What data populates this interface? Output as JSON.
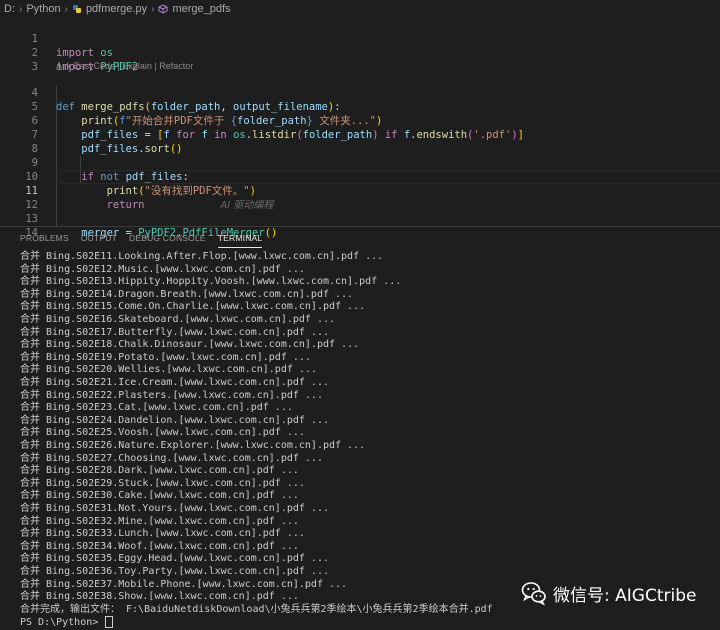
{
  "breadcrumb": {
    "drive": "D:",
    "folder": "Python",
    "file": "pdfmerge.py",
    "symbol": "merge_pdfs"
  },
  "editor": {
    "codelens": "Ask EasyCode | Explain | Refactor",
    "ghost_text": "AI 驱动编程",
    "line_numbers": [
      "1",
      "2",
      "3",
      "4",
      "5",
      "6",
      "7",
      "8",
      "9",
      "10",
      "11",
      "12",
      "13",
      "14"
    ],
    "line1": {
      "kw": "import",
      "mod": "os"
    },
    "line2": {
      "kw": "import",
      "mod": "PyPDF2"
    },
    "line4": {
      "kw": "def",
      "fn": "merge_pdfs",
      "p_open": "(",
      "a1": "folder_path",
      "comma": ", ",
      "a2": "output_filename",
      "p_close": ")",
      "colon": ":"
    },
    "line5": {
      "fn": "print",
      "p_open": "(",
      "fprefix": "f",
      "s1": "\"开始合并PDF文件于 ",
      "b_open": "{",
      "var": "folder_path",
      "b_close": "}",
      "s2": " 文件夹...\"",
      "p_close": ")"
    },
    "line6": {
      "var1": "pdf_files",
      "eq": " = ",
      "sq_open": "[",
      "f1": "f",
      "kw_for": " for ",
      "f2": "f",
      "kw_in": " in ",
      "mod": "os",
      "dot": ".",
      "fn": "listdir",
      "p_open": "(",
      "arg": "folder_path",
      "p_close": ")",
      "kw_if": " if ",
      "f3": "f",
      "dot2": ".",
      "fn2": "endswith",
      "p2_open": "(",
      "str": "'.pdf'",
      "p2_close": ")",
      "sq_close": "]"
    },
    "line7": {
      "var": "pdf_files",
      "dot": ".",
      "fn": "sort",
      "parens": "()"
    },
    "line9": {
      "kw_if": "if",
      "kw_not": " not ",
      "var": "pdf_files",
      "colon": ":"
    },
    "line10": {
      "fn": "print",
      "p_open": "(",
      "str": "\"没有找到PDF文件。\"",
      "p_close": ")"
    },
    "line11": {
      "kw": "return"
    },
    "line13": {
      "var": "merger",
      "eq": " = ",
      "mod": "PyPDF2",
      "dot": ".",
      "cls": "PdfFileMerger",
      "parens": "()"
    }
  },
  "panel": {
    "tabs": [
      "PROBLEMS",
      "OUTPUT",
      "DEBUG CONSOLE",
      "TERMINAL"
    ],
    "active_tab": "TERMINAL"
  },
  "terminal": {
    "lines": [
      "合并 Bing.S02E11.Looking.After.Flop.[www.lxwc.com.cn].pdf ...",
      "合并 Bing.S02E12.Music.[www.lxwc.com.cn].pdf ...",
      "合并 Bing.S02E13.Hippity.Hoppity.Voosh.[www.lxwc.com.cn].pdf ...",
      "合并 Bing.S02E14.Dragon.Breath.[www.lxwc.com.cn].pdf ...",
      "合并 Bing.S02E15.Come.On.Charlie.[www.lxwc.com.cn].pdf ...",
      "合并 Bing.S02E16.Skateboard.[www.lxwc.com.cn].pdf ...",
      "合并 Bing.S02E17.Butterfly.[www.lxwc.com.cn].pdf ...",
      "合并 Bing.S02E18.Chalk.Dinosaur.[www.lxwc.com.cn].pdf ...",
      "合并 Bing.S02E19.Potato.[www.lxwc.com.cn].pdf ...",
      "合并 Bing.S02E20.Wellies.[www.lxwc.com.cn].pdf ...",
      "合并 Bing.S02E21.Ice.Cream.[www.lxwc.com.cn].pdf ...",
      "合并 Bing.S02E22.Plasters.[www.lxwc.com.cn].pdf ...",
      "合并 Bing.S02E23.Cat.[www.lxwc.com.cn].pdf ...",
      "合并 Bing.S02E24.Dandelion.[www.lxwc.com.cn].pdf ...",
      "合并 Bing.S02E25.Voosh.[www.lxwc.com.cn].pdf ...",
      "合并 Bing.S02E26.Nature.Explorer.[www.lxwc.com.cn].pdf ...",
      "合并 Bing.S02E27.Choosing.[www.lxwc.com.cn].pdf ...",
      "合并 Bing.S02E28.Dark.[www.lxwc.com.cn].pdf ...",
      "合并 Bing.S02E29.Stuck.[www.lxwc.com.cn].pdf ...",
      "合并 Bing.S02E30.Cake.[www.lxwc.com.cn].pdf ...",
      "合并 Bing.S02E31.Not.Yours.[www.lxwc.com.cn].pdf ...",
      "合并 Bing.S02E32.Mine.[www.lxwc.com.cn].pdf ...",
      "合并 Bing.S02E33.Lunch.[www.lxwc.com.cn].pdf ...",
      "合并 Bing.S02E34.Woof.[www.lxwc.com.cn].pdf ...",
      "合并 Bing.S02E35.Eggy.Head.[www.lxwc.com.cn].pdf ...",
      "合并 Bing.S02E36.Toy.Party.[www.lxwc.com.cn].pdf ...",
      "合并 Bing.S02E37.Mobile.Phone.[www.lxwc.com.cn].pdf ...",
      "合并 Bing.S02E38.Show.[www.lxwc.com.cn].pdf ...",
      "合并完成，输出文件： F:\\BaiduNetdiskDownload\\小兔兵兵第2季绘本\\小兔兵兵第2季绘本合并.pdf"
    ],
    "prompt": "PS D:\\Python> "
  },
  "watermark": {
    "text": "微信号: AIGCtribe",
    "icon": "wechat-icon"
  }
}
